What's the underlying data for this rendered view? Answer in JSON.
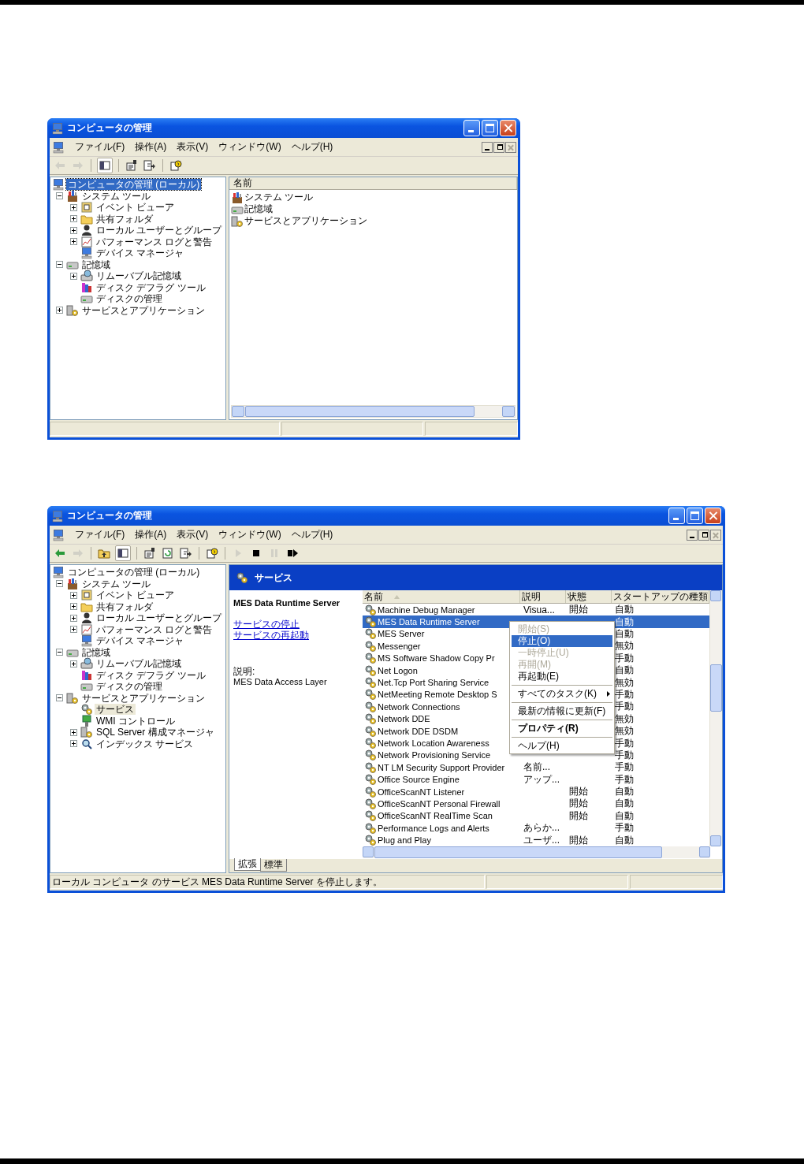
{
  "windows": [
    {
      "title": "コンピュータの管理",
      "tree_focused": true,
      "menu": [
        "ファイル(F)",
        "操作(A)",
        "表示(V)",
        "ウィンドウ(W)",
        "ヘルプ(H)"
      ],
      "toolbar": [
        {
          "kind": "back",
          "disabled": true
        },
        {
          "kind": "forward",
          "disabled": true
        },
        {
          "kind": "separator"
        },
        {
          "kind": "console-tree",
          "disabled": false
        },
        {
          "kind": "separator"
        },
        {
          "kind": "properties",
          "disabled": false
        },
        {
          "kind": "export",
          "disabled": false
        },
        {
          "kind": "separator"
        },
        {
          "kind": "help",
          "disabled": false
        }
      ],
      "tree": [
        {
          "label": "コンピュータの管理 (ローカル)",
          "kind": "computer",
          "selected": true,
          "children": [
            {
              "label": "システム ツール",
              "kind": "tools",
              "selected": false,
              "expanded": true,
              "children": [
                {
                  "label": "イベント ビューア",
                  "kind": "event",
                  "selected": false,
                  "expanded": false
                },
                {
                  "label": "共有フォルダ",
                  "kind": "folder",
                  "selected": false,
                  "expanded": false
                },
                {
                  "label": "ローカル ユーザーとグループ",
                  "kind": "users",
                  "selected": false,
                  "expanded": false
                },
                {
                  "label": "パフォーマンス ログと警告",
                  "kind": "perf",
                  "selected": false,
                  "expanded": false
                },
                {
                  "label": "デバイス マネージャ",
                  "kind": "computer",
                  "selected": false
                }
              ]
            },
            {
              "label": "記憶域",
              "kind": "storage",
              "selected": false,
              "expanded": true,
              "children": [
                {
                  "label": "リムーバブル記憶域",
                  "kind": "removable",
                  "selected": false,
                  "expanded": false
                },
                {
                  "label": "ディスク デフラグ ツール",
                  "kind": "defrag",
                  "selected": false
                },
                {
                  "label": "ディスクの管理",
                  "kind": "storage",
                  "selected": false
                }
              ]
            },
            {
              "label": "サービスとアプリケーション",
              "kind": "services-apps",
              "selected": false,
              "expanded": false
            }
          ]
        }
      ],
      "content": {
        "kind": "list",
        "columns": [
          "名前"
        ],
        "items": [
          {
            "label": "システム ツール",
            "kind": "tools"
          },
          {
            "label": "記憶域",
            "kind": "storage"
          },
          {
            "label": "サービスとアプリケーション",
            "kind": "services-apps"
          }
        ]
      }
    },
    {
      "title": "コンピュータの管理",
      "tree_focused": false,
      "menu": [
        "ファイル(F)",
        "操作(A)",
        "表示(V)",
        "ウィンドウ(W)",
        "ヘルプ(H)"
      ],
      "toolbar": [
        {
          "kind": "back",
          "disabled": false
        },
        {
          "kind": "forward",
          "disabled": true
        },
        {
          "kind": "separator"
        },
        {
          "kind": "up",
          "disabled": false
        },
        {
          "kind": "console-tree",
          "disabled": false
        },
        {
          "kind": "separator"
        },
        {
          "kind": "properties",
          "disabled": false
        },
        {
          "kind": "refresh",
          "disabled": false
        },
        {
          "kind": "export",
          "disabled": false
        },
        {
          "kind": "separator"
        },
        {
          "kind": "help",
          "disabled": false
        },
        {
          "kind": "separator"
        },
        {
          "kind": "play",
          "disabled": true
        },
        {
          "kind": "stop",
          "disabled": false
        },
        {
          "kind": "pause",
          "disabled": true
        },
        {
          "kind": "resume",
          "disabled": false
        }
      ],
      "tree": [
        {
          "label": "コンピュータの管理 (ローカル)",
          "kind": "computer",
          "selected": false,
          "children": [
            {
              "label": "システム ツール",
              "kind": "tools",
              "selected": false,
              "expanded": true,
              "children": [
                {
                  "label": "イベント ビューア",
                  "kind": "event",
                  "selected": false,
                  "expanded": false
                },
                {
                  "label": "共有フォルダ",
                  "kind": "folder",
                  "selected": false,
                  "expanded": false
                },
                {
                  "label": "ローカル ユーザーとグループ",
                  "kind": "users",
                  "selected": false,
                  "expanded": false
                },
                {
                  "label": "パフォーマンス ログと警告",
                  "kind": "perf",
                  "selected": false,
                  "expanded": false
                },
                {
                  "label": "デバイス マネージャ",
                  "kind": "computer",
                  "selected": false
                }
              ]
            },
            {
              "label": "記憶域",
              "kind": "storage",
              "selected": false,
              "expanded": true,
              "children": [
                {
                  "label": "リムーバブル記憶域",
                  "kind": "removable",
                  "selected": false,
                  "expanded": false
                },
                {
                  "label": "ディスク デフラグ ツール",
                  "kind": "defrag",
                  "selected": false
                },
                {
                  "label": "ディスクの管理",
                  "kind": "storage",
                  "selected": false
                }
              ]
            },
            {
              "label": "サービスとアプリケーション",
              "kind": "services-apps",
              "selected": false,
              "expanded": true,
              "children": [
                {
                  "label": "サービス",
                  "kind": "service",
                  "selected": true
                },
                {
                  "label": "WMI コントロール",
                  "kind": "wmi",
                  "selected": false
                },
                {
                  "label": "SQL Server 構成マネージャ",
                  "kind": "services-apps",
                  "selected": false,
                  "expanded": false
                },
                {
                  "label": "インデックス サービス",
                  "kind": "index",
                  "selected": false,
                  "expanded": false
                }
              ]
            }
          ]
        }
      ],
      "content": {
        "kind": "services",
        "header": "サービス",
        "detail": {
          "title": "MES Data Runtime Server",
          "links": [
            "サービスの停止",
            "サービスの再起動"
          ],
          "description_label": "説明:",
          "description": "MES Data Access Layer"
        },
        "columns": [
          {
            "label": "名前",
            "sorted": true
          },
          {
            "label": "説明",
            "sorted": false
          },
          {
            "label": "状態",
            "sorted": false
          },
          {
            "label": "スタートアップの種類",
            "sorted": false
          }
        ],
        "rows": [
          {
            "name": "Machine Debug Manager",
            "description": "Visua...",
            "status": "開始",
            "startup": "自動",
            "selected": false
          },
          {
            "name": "MES Data Runtime Server",
            "startup": "自動",
            "selected": true
          },
          {
            "name": "MES Server",
            "startup": "自動",
            "selected": false
          },
          {
            "name": "Messenger",
            "startup": "無効",
            "selected": false
          },
          {
            "name": "MS Software Shadow Copy Pr",
            "startup": "手動",
            "selected": false
          },
          {
            "name": "Net Logon",
            "startup": "自動",
            "selected": false
          },
          {
            "name": "Net.Tcp Port Sharing Service",
            "startup": "無効",
            "selected": false
          },
          {
            "name": "NetMeeting Remote Desktop S",
            "startup": "手動",
            "selected": false
          },
          {
            "name": "Network Connections",
            "startup": "手動",
            "selected": false
          },
          {
            "name": "Network DDE",
            "startup": "無効",
            "selected": false
          },
          {
            "name": "Network DDE DSDM",
            "startup": "無効",
            "selected": false
          },
          {
            "name": "Network Location Awareness",
            "startup": "手動",
            "selected": false
          },
          {
            "name": "Network Provisioning Service",
            "startup": "手動",
            "selected": false
          },
          {
            "name": "NT LM Security Support Provider",
            "description": "名前...",
            "startup": "手動",
            "selected": false
          },
          {
            "name": "Office Source Engine",
            "description": "アップ...",
            "startup": "手動",
            "selected": false
          },
          {
            "name": "OfficeScanNT Listener",
            "status": "開始",
            "startup": "自動",
            "selected": false
          },
          {
            "name": "OfficeScanNT Personal Firewall",
            "status": "開始",
            "startup": "自動",
            "selected": false
          },
          {
            "name": "OfficeScanNT RealTime Scan",
            "status": "開始",
            "startup": "自動",
            "selected": false
          },
          {
            "name": "Performance Logs and Alerts",
            "description": "あらか...",
            "startup": "手動",
            "selected": false
          },
          {
            "name": "Plug and Play",
            "description": "ユーザ...",
            "status": "開始",
            "startup": "自動",
            "selected": false
          }
        ],
        "tabs": [
          {
            "label": "拡張",
            "selected": true
          },
          {
            "label": "標準",
            "selected": false
          }
        ],
        "context_menu": [
          {
            "kind": "item",
            "label": "開始(S)",
            "disabled": true,
            "selected": false,
            "default": false
          },
          {
            "kind": "item",
            "label": "停止(O)",
            "disabled": false,
            "selected": true,
            "default": false
          },
          {
            "kind": "item",
            "label": "一時停止(U)",
            "disabled": true,
            "selected": false,
            "default": false
          },
          {
            "kind": "item",
            "label": "再開(M)",
            "disabled": true,
            "selected": false,
            "default": false
          },
          {
            "kind": "item",
            "label": "再起動(E)",
            "disabled": false,
            "selected": false,
            "default": false
          },
          {
            "kind": "separator"
          },
          {
            "kind": "submenu",
            "label": "すべてのタスク(K)",
            "disabled": false,
            "selected": false,
            "default": false
          },
          {
            "kind": "separator"
          },
          {
            "kind": "item",
            "label": "最新の情報に更新(F)",
            "disabled": false,
            "selected": false,
            "default": false
          },
          {
            "kind": "separator"
          },
          {
            "kind": "item",
            "label": "プロパティ(R)",
            "disabled": false,
            "selected": false,
            "default": true
          },
          {
            "kind": "separator"
          },
          {
            "kind": "item",
            "label": "ヘルプ(H)",
            "disabled": false,
            "selected": false,
            "default": false
          }
        ]
      },
      "status_text": "ローカル コンピュータ のサービス MES Data Runtime Server を停止します。"
    }
  ]
}
